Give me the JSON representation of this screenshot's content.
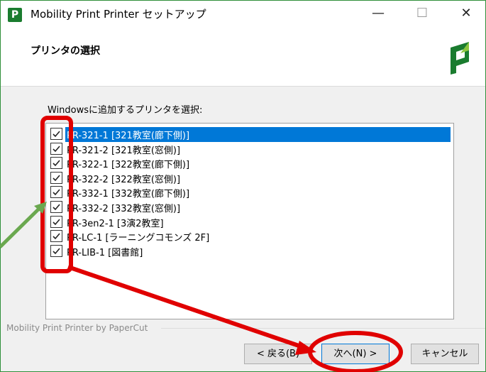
{
  "window": {
    "title": "Mobility Print Printer セットアップ",
    "app_icon_letter": "P",
    "min_label": "—",
    "max_label": "☐",
    "close_label": "✕"
  },
  "header": {
    "title": "プリンタの選択"
  },
  "main": {
    "label": "Windowsに追加するプリンタを選択:",
    "printers": [
      {
        "label": "PR-321-1 [321教室(廊下側)]",
        "checked": true,
        "selected": true
      },
      {
        "label": "PR-321-2 [321教室(窓側)]",
        "checked": true
      },
      {
        "label": "PR-322-1 [322教室(廊下側)]",
        "checked": true
      },
      {
        "label": "PR-322-2 [322教室(窓側)]",
        "checked": true
      },
      {
        "label": "PR-332-1 [332教室(廊下側)]",
        "checked": true
      },
      {
        "label": "PR-332-2 [332教室(窓側)]",
        "checked": true
      },
      {
        "label": "PR-3en2-1 [3演2教室]",
        "checked": true
      },
      {
        "label": "PR-LC-1 [ラーニングコモンズ 2F]",
        "checked": true
      },
      {
        "label": "PR-LIB-1 [図書館]",
        "checked": true
      }
    ]
  },
  "footer": {
    "brand": "Mobility Print Printer by PaperCut"
  },
  "buttons": {
    "back": "< 戻る(B)",
    "next": "次へ(N) >",
    "cancel": "キャンセル"
  },
  "colors": {
    "brand": "#1a7c2f",
    "selection": "#0078d7",
    "annotation": "#e00000",
    "arrow_green": "#6aa84f"
  }
}
